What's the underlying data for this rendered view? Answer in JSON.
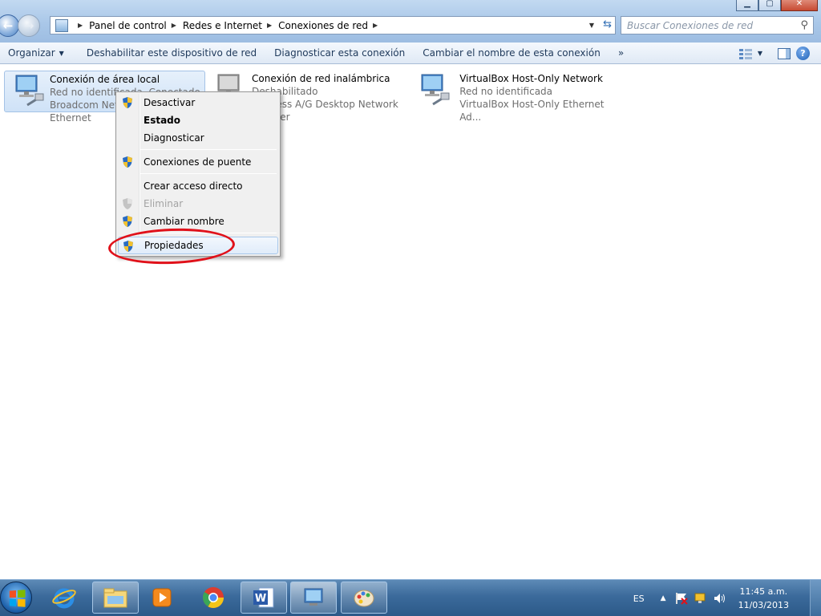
{
  "address": {
    "breadcrumbs": [
      "Panel de control",
      "Redes e Internet",
      "Conexiones de red"
    ]
  },
  "search": {
    "placeholder": "Buscar Conexiones de red"
  },
  "toolbar": {
    "organize": "Organizar",
    "disable": "Deshabilitar este dispositivo de red",
    "diagnose": "Diagnosticar esta conexión",
    "rename": "Cambiar el nombre de esta conexión",
    "more": "»"
  },
  "connections": [
    {
      "name": "Conexión de área local",
      "status": "Red no identificada, Conectado",
      "device": "Broadcom NetXtreme Gigabit Ethernet"
    },
    {
      "name": "Conexión de red inalámbrica",
      "status": "Deshabilitado",
      "device": "Wireless A/G Desktop Network Adapter"
    },
    {
      "name": "VirtualBox Host-Only Network",
      "status": "Red no identificada",
      "device": "VirtualBox Host-Only Ethernet Ad..."
    }
  ],
  "context_menu": {
    "items": [
      {
        "label": "Desactivar"
      },
      {
        "label": "Estado"
      },
      {
        "label": "Diagnosticar"
      },
      {
        "label": "Conexiones de puente"
      },
      {
        "label": "Crear acceso directo"
      },
      {
        "label": "Eliminar"
      },
      {
        "label": "Cambiar nombre"
      },
      {
        "label": "Propiedades"
      }
    ]
  },
  "taskbar": {
    "language": "ES",
    "time": "11:45 a.m.",
    "date": "11/03/2013"
  },
  "colors": {
    "highlight_ring": "#e0111a",
    "taskbar": "#3b6a9b",
    "selection": "#cfe2f7"
  },
  "icons": [
    "back-arrow-icon",
    "forward-arrow-icon",
    "control-panel-icon",
    "refresh-icon",
    "search-icon",
    "view-options-icon",
    "preview-pane-icon",
    "help-icon",
    "network-adapter-icon",
    "uac-shield-icon",
    "start-orb-icon",
    "internet-explorer-icon",
    "windows-explorer-icon",
    "media-player-icon",
    "chrome-icon",
    "word-icon",
    "network-connections-icon",
    "paint-icon",
    "flag-icon",
    "network-tray-icon",
    "volume-icon"
  ]
}
